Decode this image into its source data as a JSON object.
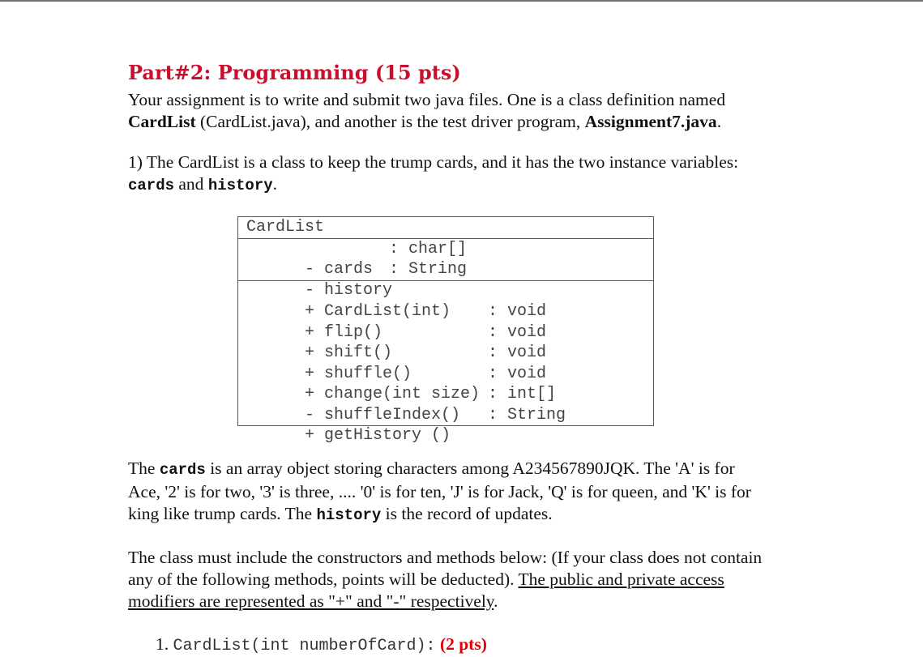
{
  "heading": "Part#2: Programming (15 pts)",
  "intro": {
    "line1": "Your assignment is to write and submit two java files. One is a class definition named",
    "classname": "CardList",
    "line2_mid": " (CardList.java), and another is the test driver program, ",
    "driver": "Assignment7.java",
    "line2_end": "."
  },
  "item1": {
    "text": "1) The CardList is a class to keep the trump cards, and it has the two instance variables:",
    "var1": "cards",
    "and": " and ",
    "var2": "history",
    "end": "."
  },
  "uml": {
    "class_name": "CardList",
    "attributes": [
      {
        "name": "- cards",
        "type": ": char[]"
      },
      {
        "name": "- history",
        "type": ": String"
      }
    ],
    "methods": [
      {
        "name": "+ CardList(int)",
        "type": ""
      },
      {
        "name": "+ flip()",
        "type": ": void"
      },
      {
        "name": "+ shift()",
        "type": ": void"
      },
      {
        "name": "+ shuffle()",
        "type": ": void"
      },
      {
        "name": "+ change(int size)",
        "type": ": void"
      },
      {
        "name": "- shuffleIndex()",
        "type": ": int[]"
      },
      {
        "name": "+ getHistory ()",
        "type": ": String"
      }
    ]
  },
  "cards_para": {
    "pre": "The ",
    "var": "cards",
    "text1": " is an array object storing characters among A234567890JQK. The 'A' is for",
    "line2": "Ace, '2' is for two, '3' is three, .... '0' is for ten, 'J' is for Jack, 'Q' is for queen, and 'K' is for",
    "line3_pre": "king like trump cards. The ",
    "var2": "history",
    "line3_end": " is the record of updates."
  },
  "class_para": {
    "line1": "The class must include the constructors and methods below: (If your class does not contain",
    "line2_plain": "any of the following methods, points will be deducted). ",
    "line2_u": "The public and private access",
    "line3_u": "modifiers are represented as \"+\" and \"-\" respectively",
    "line3_end": "."
  },
  "list_item": {
    "number": "1.",
    "signature": "CardList(int numberOfCard):",
    "pts": "(2 pts)"
  }
}
